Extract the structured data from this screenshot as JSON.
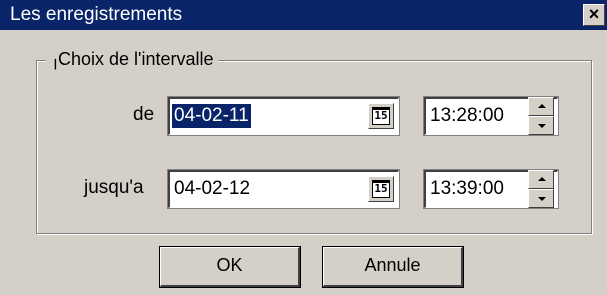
{
  "window": {
    "title": "Les enregistrements",
    "close_glyph": "×"
  },
  "group": {
    "legend": "Choix de l'intervalle"
  },
  "from": {
    "label": "de",
    "date": "04-02-11",
    "calendar_icon": "15",
    "time": "13:28:00"
  },
  "to": {
    "label": "jusqu'a",
    "date": "04-02-12",
    "calendar_icon": "15",
    "time": "13:39:00"
  },
  "buttons": {
    "ok": "OK",
    "cancel": "Annule"
  },
  "colors": {
    "titlebar": "#0a246a",
    "face": "#d4d0c8",
    "selection": "#0a246a"
  }
}
